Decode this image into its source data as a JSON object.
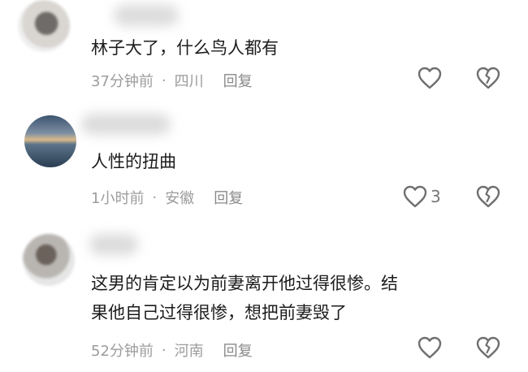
{
  "comments": [
    {
      "text": "林子大了，什么鸟人都有",
      "time": "37分钟前",
      "separator": "·",
      "location": "四川",
      "reply_label": "回复",
      "like_count": ""
    },
    {
      "text": "人性的扭曲",
      "time": "1小时前",
      "separator": "·",
      "location": "安徽",
      "reply_label": "回复",
      "like_count": "3"
    },
    {
      "text_line1": "这男的肯定以为前妻离开他过得很惨。结",
      "text_line2": "果他自己过得很惨，想把前妻毁了",
      "time": "52分钟前",
      "separator": "·",
      "location": "河南",
      "reply_label": "回复",
      "like_count": ""
    }
  ],
  "icons": {
    "like": "heart-outline-icon",
    "dislike": "broken-heart-icon"
  },
  "colors": {
    "meta": "#9c9c9c",
    "text": "#1c1c1c",
    "icon": "#6f6f6f"
  }
}
